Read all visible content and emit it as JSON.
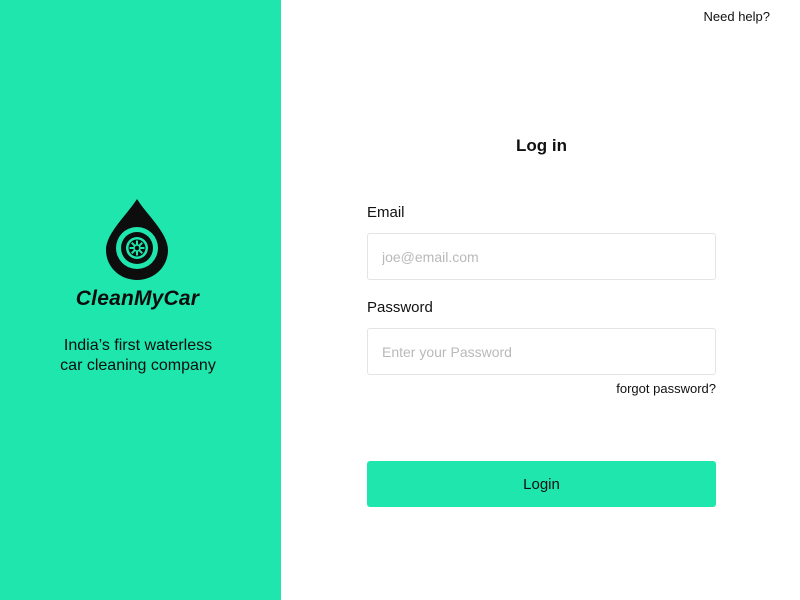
{
  "brand": {
    "name": "CleanMyCar",
    "logo_icon": "water-drop-wheel-icon",
    "tagline_line1": "India’s first waterless",
    "tagline_line2": "car cleaning company",
    "color": "#1ee6ad"
  },
  "header": {
    "help_link": "Need help?"
  },
  "form": {
    "title": "Log in",
    "email": {
      "label": "Email",
      "value": "",
      "placeholder": "joe@email.com"
    },
    "password": {
      "label": "Password",
      "value": "",
      "placeholder": "Enter your Password"
    },
    "forgot_link": "forgot password?",
    "submit_label": "Login"
  }
}
